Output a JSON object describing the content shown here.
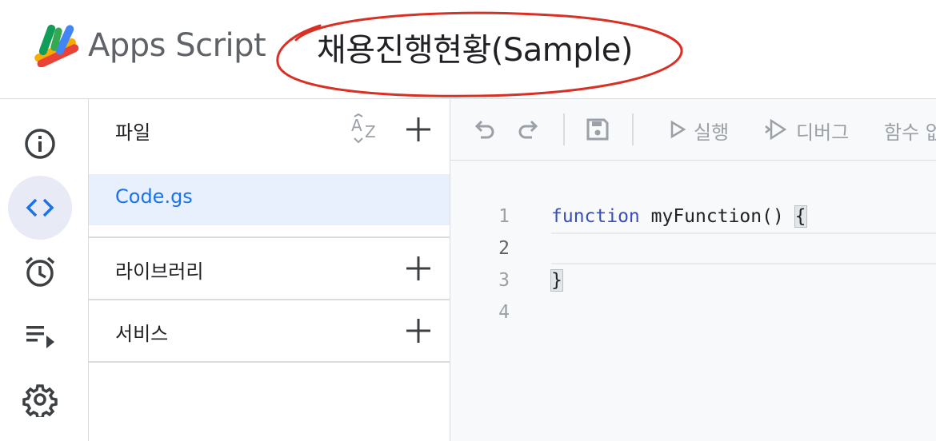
{
  "header": {
    "app_name": "Apps Script",
    "project_title": "채용진행현황(Sample)"
  },
  "rail": {
    "items": [
      {
        "icon": "info-icon",
        "active": false
      },
      {
        "icon": "code-icon",
        "active": true
      },
      {
        "icon": "alarm-clock-icon",
        "active": false
      },
      {
        "icon": "executions-icon",
        "active": false
      },
      {
        "icon": "gear-icon",
        "active": false
      }
    ]
  },
  "files_panel": {
    "files_label": "파일",
    "files": [
      "Code.gs"
    ],
    "libraries_label": "라이브러리",
    "services_label": "서비스"
  },
  "toolbar": {
    "run_label": "실행",
    "debug_label": "디버그",
    "function_label": "함수 없"
  },
  "editor": {
    "line_numbers": [
      "1",
      "2",
      "3",
      "4"
    ],
    "keyword": "function",
    "signature": " myFunction() ",
    "open_brace": "{",
    "close_brace": "}"
  },
  "colors": {
    "accent": "#1a73e8",
    "selected_bg": "#e8f0fe",
    "annotation": "#d93025"
  }
}
